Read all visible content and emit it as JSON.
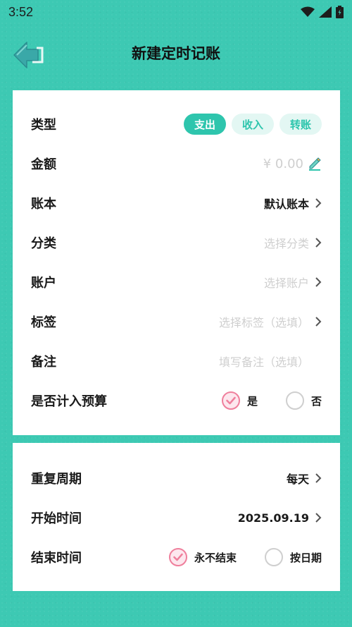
{
  "status": {
    "time": "3:52",
    "icons": [
      "wifi-icon",
      "signal-icon",
      "battery-icon"
    ]
  },
  "header": {
    "title": "新建定时记账",
    "back_icon": "back-arrow-icon"
  },
  "form": {
    "type": {
      "label": "类型",
      "options": [
        "支出",
        "收入",
        "转账"
      ],
      "selected": "支出"
    },
    "amount": {
      "label": "金额",
      "placeholder": "¥ 0.00",
      "icon": "edit-pencil-icon"
    },
    "book": {
      "label": "账本",
      "value": "默认账本"
    },
    "category": {
      "label": "分类",
      "placeholder": "选择分类"
    },
    "account": {
      "label": "账户",
      "placeholder": "选择账户"
    },
    "tags": {
      "label": "标签",
      "placeholder": "选择标签（选填）"
    },
    "note": {
      "label": "备注",
      "placeholder": "填写备注（选填）"
    },
    "budget": {
      "label": "是否计入预算",
      "options": [
        "是",
        "否"
      ],
      "selected": "是"
    }
  },
  "schedule": {
    "repeat": {
      "label": "重复周期",
      "value": "每天"
    },
    "start": {
      "label": "开始时间",
      "value": "2025.09.19"
    },
    "end": {
      "label": "结束时间",
      "options": [
        "永不结束",
        "按日期"
      ],
      "selected": "永不结束"
    }
  },
  "colors": {
    "background": "#3dc9b3",
    "accent": "#2ec5ad",
    "accent_light": "#e3f7f3",
    "radio_selected": "#ef7f9c",
    "muted_text": "#cfcfcf"
  }
}
